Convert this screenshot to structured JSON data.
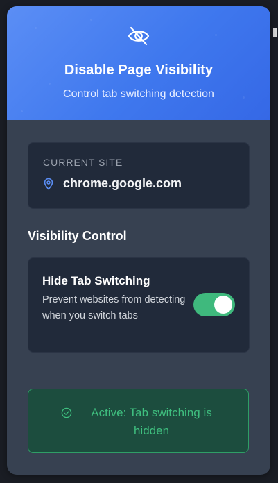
{
  "header": {
    "icon": "eye-off-icon",
    "title": "Disable Page Visibility",
    "subtitle": "Control tab switching detection"
  },
  "current_site": {
    "label": "CURRENT SITE",
    "icon": "location-pin-icon",
    "domain": "chrome.google.com"
  },
  "visibility_control": {
    "section_title": "Visibility Control",
    "toggle": {
      "title": "Hide Tab Switching",
      "description": "Prevent websites from detecting when you switch tabs",
      "enabled": true
    }
  },
  "status": {
    "icon": "check-circle-icon",
    "text": "Active: Tab switching is hidden"
  },
  "colors": {
    "header_gradient_start": "#5b8ef5",
    "header_gradient_end": "#3568e6",
    "panel_bg": "#374151",
    "card_bg": "#212a3a",
    "toggle_on": "#3fb97d",
    "status_bg": "#1c4d3e",
    "status_text": "#3fbf7f"
  }
}
